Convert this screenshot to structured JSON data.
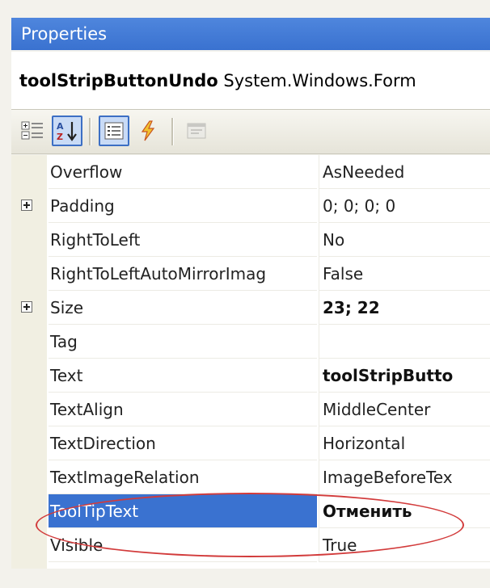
{
  "window": {
    "title": "Properties"
  },
  "object_selector": {
    "name": "toolStripButtonUndo",
    "type": "System.Windows.Form"
  },
  "toolbar": {
    "buttons": [
      {
        "icon": "categorized-icon",
        "label": "Categorized"
      },
      {
        "icon": "alphabetical-sort-icon",
        "label": "Alphabetical",
        "active": true
      },
      {
        "icon": "properties-icon",
        "label": "Properties",
        "active": true
      },
      {
        "icon": "events-lightning-icon",
        "label": "Events"
      },
      {
        "icon": "property-pages-icon",
        "label": "Property Pages",
        "disabled": true
      }
    ]
  },
  "properties": {
    "rows": [
      {
        "name": "Overflow",
        "value": "AsNeeded",
        "expandable": false,
        "bold": false
      },
      {
        "name": "Padding",
        "value": "0; 0; 0; 0",
        "expandable": true,
        "bold": false
      },
      {
        "name": "RightToLeft",
        "value": "No",
        "expandable": false,
        "bold": false
      },
      {
        "name": "RightToLeftAutoMirrorImag",
        "value": "False",
        "expandable": false,
        "bold": false
      },
      {
        "name": "Size",
        "value": "23; 22",
        "expandable": true,
        "bold": true
      },
      {
        "name": "Tag",
        "value": "",
        "expandable": false,
        "bold": false
      },
      {
        "name": "Text",
        "value": "toolStripButto",
        "expandable": false,
        "bold": true
      },
      {
        "name": "TextAlign",
        "value": "MiddleCenter",
        "expandable": false,
        "bold": false
      },
      {
        "name": "TextDirection",
        "value": "Horizontal",
        "expandable": false,
        "bold": false
      },
      {
        "name": "TextImageRelation",
        "value": "ImageBeforeTex",
        "expandable": false,
        "bold": false
      },
      {
        "name": "ToolTipText",
        "value": "Отменить",
        "expandable": false,
        "bold": true,
        "selected": true
      },
      {
        "name": "Visible",
        "value": "True",
        "expandable": false,
        "bold": false
      }
    ]
  },
  "colors": {
    "title_bar": "#3a72d0",
    "selection": "#3a72d0",
    "annotation_ellipse": "#d23b3b"
  }
}
